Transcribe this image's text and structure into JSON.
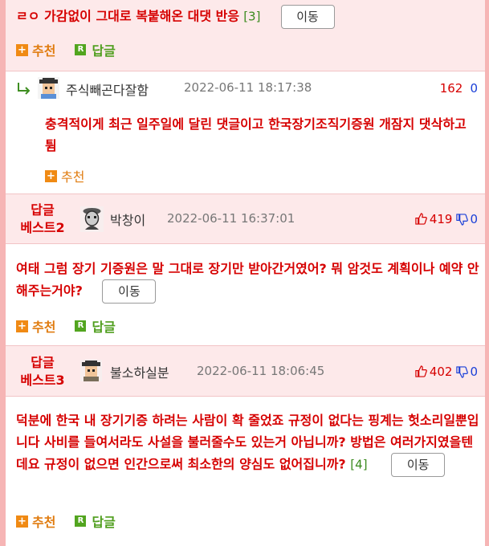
{
  "top": {
    "text": "ㄹㅇ 가감없이 그대로 복붙해온 대댓 반응",
    "count": "[3]",
    "move_label": "이동",
    "recommend": "추천",
    "reply": "답글"
  },
  "subreply": {
    "nickname": "주식빼곤다잘함",
    "date": "2022-06-11 18:17:38",
    "vote_up": "162",
    "vote_down": "0",
    "text": "충격적이게 최근 일주일에 달린 댓글이고 한국장기조직기증원 개잠지 댓삭하고 튐",
    "recommend": "추천"
  },
  "best2": {
    "badge_line1": "답글",
    "badge_line2": "베스트2",
    "nickname": "박창이",
    "date": "2022-06-11 16:37:01",
    "vote_up": "419",
    "vote_down": "0",
    "text": "여태 그럼 장기 기증원은 말 그대로 장기만 받아간거였어? 뭐 암것도 계획이나 예약 안해주는거야?",
    "move_label": "이동",
    "recommend": "추천",
    "reply": "답글"
  },
  "best3": {
    "badge_line1": "답글",
    "badge_line2": "베스트3",
    "nickname": "불소하실분",
    "date": "2022-06-11 18:06:45",
    "vote_up": "402",
    "vote_down": "0",
    "text": "덕분에 한국 내 장기기증 하려는 사람이 확 줄었죠 규정이 없다는 핑계는 헛소리일뿐입니다 사비를 들여서라도 사설을 불러줄수도 있는거 아닙니까? 방법은 여러가지였을텐데요 규정이 없으면 인간으로써 최소한의 양심도 없어집니까?",
    "count": "[4]",
    "move_label": "이동",
    "recommend": "추천",
    "reply": "답글"
  },
  "colors": {
    "accent_red": "#d60000",
    "vote_blue": "#1b40d8",
    "recommend_orange": "#f08a14",
    "reply_green": "#52a51f",
    "best_bg": "#fde9ea",
    "frame": "#f6b5b5"
  },
  "icons": [
    "plus-icon",
    "reply-r-icon",
    "reply-arrow-icon",
    "avatar-icon",
    "thumbs-up-icon",
    "thumbs-down-icon"
  ]
}
